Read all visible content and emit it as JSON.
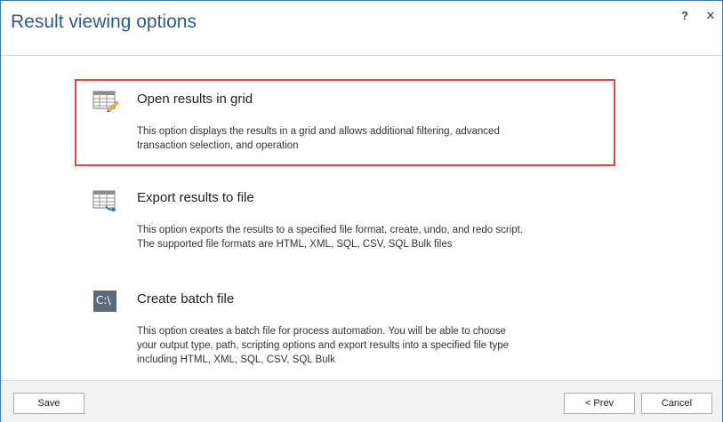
{
  "dialog": {
    "title": "Result viewing options",
    "help_glyph": "?",
    "close_glyph": "✕"
  },
  "options": [
    {
      "id": "grid",
      "title": "Open results in grid",
      "description": "This option displays the results in a grid and allows additional filtering, advanced transaction selection, and operation",
      "icon": "grid-icon",
      "selected": true
    },
    {
      "id": "export",
      "title": "Export results to file",
      "description": "This option exports the results to a specified file format, create, undo, and redo script. The supported file formats are HTML, XML, SQL, CSV, SQL Bulk files",
      "icon": "export-icon",
      "selected": false
    },
    {
      "id": "batch",
      "title": "Create batch file",
      "description": "This option creates a batch file for process automation. You will be able to choose your output type, path, scripting options and export results into a specified file type including HTML, XML, SQL, CSV, SQL Bulk",
      "icon": "batch-file-icon",
      "icon_text": "C:\\",
      "selected": false
    }
  ],
  "footer": {
    "save_label": "Save",
    "prev_label": "< Prev",
    "cancel_label": "Cancel"
  },
  "colors": {
    "title": "#2d5a8c",
    "selection_border": "#e04848",
    "window_border": "#3c78b5",
    "footer_bg": "#f2f2f2"
  }
}
